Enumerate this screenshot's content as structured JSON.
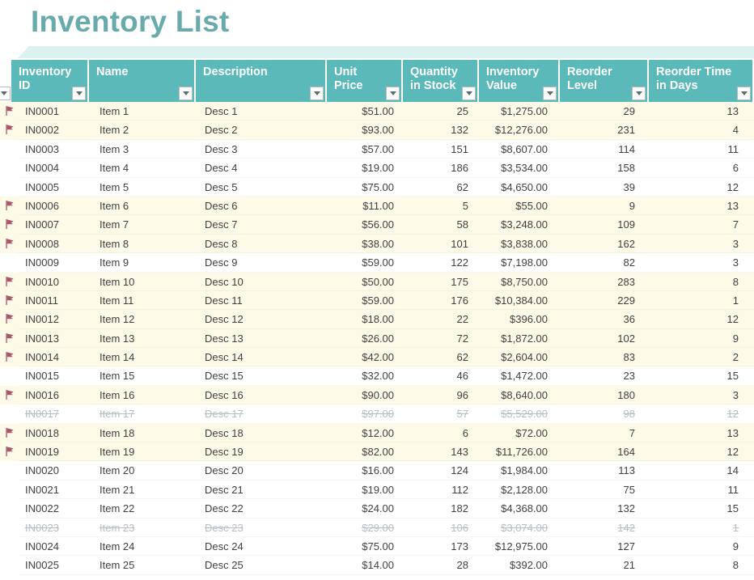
{
  "page": {
    "title": "Inventory List"
  },
  "theme": {
    "header_bg": "#5cb9b9",
    "title_color": "#69aaad",
    "band_color": "#dcf1f2",
    "flag_row_bg": "#fdfbe8",
    "plain_row_bg": "#ffffff",
    "disabled_text": "#b6bdc4",
    "flag_color": "#a8566a",
    "text_color": "#3f3f3f"
  },
  "table": {
    "filter_icon": "chevron-down-icon",
    "flag_icon": "flag-icon",
    "columns": [
      {
        "key": "flag",
        "label": "",
        "align": "left",
        "filter": true
      },
      {
        "key": "id",
        "label": "Inventory\nID",
        "align": "left",
        "filter": true
      },
      {
        "key": "name",
        "label": "Name",
        "align": "left",
        "filter": true
      },
      {
        "key": "desc",
        "label": "Description",
        "align": "left",
        "filter": true
      },
      {
        "key": "price",
        "label": "Unit Price",
        "align": "right",
        "filter": true
      },
      {
        "key": "qty",
        "label": "Quantity\nin Stock",
        "align": "right",
        "filter": true
      },
      {
        "key": "value",
        "label": "Inventory\nValue",
        "align": "right",
        "filter": true
      },
      {
        "key": "reorder",
        "label": "Reorder\nLevel",
        "align": "right",
        "filter": true
      },
      {
        "key": "days",
        "label": "Reorder Time\nin Days",
        "align": "right",
        "filter": true
      }
    ],
    "rows": [
      {
        "flag": true,
        "disabled": false,
        "id": "IN0001",
        "name": "Item 1",
        "desc": "Desc 1",
        "price": "$51.00",
        "qty": "25",
        "value": "$1,275.00",
        "reorder": "29",
        "days": "13"
      },
      {
        "flag": true,
        "disabled": false,
        "id": "IN0002",
        "name": "Item 2",
        "desc": "Desc 2",
        "price": "$93.00",
        "qty": "132",
        "value": "$12,276.00",
        "reorder": "231",
        "days": "4"
      },
      {
        "flag": false,
        "disabled": false,
        "id": "IN0003",
        "name": "Item 3",
        "desc": "Desc 3",
        "price": "$57.00",
        "qty": "151",
        "value": "$8,607.00",
        "reorder": "114",
        "days": "11"
      },
      {
        "flag": false,
        "disabled": false,
        "id": "IN0004",
        "name": "Item 4",
        "desc": "Desc 4",
        "price": "$19.00",
        "qty": "186",
        "value": "$3,534.00",
        "reorder": "158",
        "days": "6"
      },
      {
        "flag": false,
        "disabled": false,
        "id": "IN0005",
        "name": "Item 5",
        "desc": "Desc 5",
        "price": "$75.00",
        "qty": "62",
        "value": "$4,650.00",
        "reorder": "39",
        "days": "12"
      },
      {
        "flag": true,
        "disabled": false,
        "id": "IN0006",
        "name": "Item 6",
        "desc": "Desc 6",
        "price": "$11.00",
        "qty": "5",
        "value": "$55.00",
        "reorder": "9",
        "days": "13"
      },
      {
        "flag": true,
        "disabled": false,
        "id": "IN0007",
        "name": "Item 7",
        "desc": "Desc 7",
        "price": "$56.00",
        "qty": "58",
        "value": "$3,248.00",
        "reorder": "109",
        "days": "7"
      },
      {
        "flag": true,
        "disabled": false,
        "id": "IN0008",
        "name": "Item 8",
        "desc": "Desc 8",
        "price": "$38.00",
        "qty": "101",
        "value": "$3,838.00",
        "reorder": "162",
        "days": "3"
      },
      {
        "flag": false,
        "disabled": false,
        "id": "IN0009",
        "name": "Item 9",
        "desc": "Desc 9",
        "price": "$59.00",
        "qty": "122",
        "value": "$7,198.00",
        "reorder": "82",
        "days": "3"
      },
      {
        "flag": true,
        "disabled": false,
        "id": "IN0010",
        "name": "Item 10",
        "desc": "Desc 10",
        "price": "$50.00",
        "qty": "175",
        "value": "$8,750.00",
        "reorder": "283",
        "days": "8"
      },
      {
        "flag": true,
        "disabled": false,
        "id": "IN0011",
        "name": "Item 11",
        "desc": "Desc 11",
        "price": "$59.00",
        "qty": "176",
        "value": "$10,384.00",
        "reorder": "229",
        "days": "1"
      },
      {
        "flag": true,
        "disabled": false,
        "id": "IN0012",
        "name": "Item 12",
        "desc": "Desc 12",
        "price": "$18.00",
        "qty": "22",
        "value": "$396.00",
        "reorder": "36",
        "days": "12"
      },
      {
        "flag": true,
        "disabled": false,
        "id": "IN0013",
        "name": "Item 13",
        "desc": "Desc 13",
        "price": "$26.00",
        "qty": "72",
        "value": "$1,872.00",
        "reorder": "102",
        "days": "9"
      },
      {
        "flag": true,
        "disabled": false,
        "id": "IN0014",
        "name": "Item 14",
        "desc": "Desc 14",
        "price": "$42.00",
        "qty": "62",
        "value": "$2,604.00",
        "reorder": "83",
        "days": "2"
      },
      {
        "flag": false,
        "disabled": false,
        "id": "IN0015",
        "name": "Item 15",
        "desc": "Desc 15",
        "price": "$32.00",
        "qty": "46",
        "value": "$1,472.00",
        "reorder": "23",
        "days": "15"
      },
      {
        "flag": true,
        "disabled": false,
        "id": "IN0016",
        "name": "Item 16",
        "desc": "Desc 16",
        "price": "$90.00",
        "qty": "96",
        "value": "$8,640.00",
        "reorder": "180",
        "days": "3"
      },
      {
        "flag": false,
        "disabled": true,
        "id": "IN0017",
        "name": "Item 17",
        "desc": "Desc 17",
        "price": "$97.00",
        "qty": "57",
        "value": "$5,529.00",
        "reorder": "98",
        "days": "12"
      },
      {
        "flag": true,
        "disabled": false,
        "id": "IN0018",
        "name": "Item 18",
        "desc": "Desc 18",
        "price": "$12.00",
        "qty": "6",
        "value": "$72.00",
        "reorder": "7",
        "days": "13"
      },
      {
        "flag": true,
        "disabled": false,
        "id": "IN0019",
        "name": "Item 19",
        "desc": "Desc 19",
        "price": "$82.00",
        "qty": "143",
        "value": "$11,726.00",
        "reorder": "164",
        "days": "12"
      },
      {
        "flag": false,
        "disabled": false,
        "id": "IN0020",
        "name": "Item 20",
        "desc": "Desc 20",
        "price": "$16.00",
        "qty": "124",
        "value": "$1,984.00",
        "reorder": "113",
        "days": "14"
      },
      {
        "flag": false,
        "disabled": false,
        "id": "IN0021",
        "name": "Item 21",
        "desc": "Desc 21",
        "price": "$19.00",
        "qty": "112",
        "value": "$2,128.00",
        "reorder": "75",
        "days": "11"
      },
      {
        "flag": false,
        "disabled": false,
        "id": "IN0022",
        "name": "Item 22",
        "desc": "Desc 22",
        "price": "$24.00",
        "qty": "182",
        "value": "$4,368.00",
        "reorder": "132",
        "days": "15"
      },
      {
        "flag": false,
        "disabled": true,
        "id": "IN0023",
        "name": "Item 23",
        "desc": "Desc 23",
        "price": "$29.00",
        "qty": "106",
        "value": "$3,074.00",
        "reorder": "142",
        "days": "1"
      },
      {
        "flag": false,
        "disabled": false,
        "id": "IN0024",
        "name": "Item 24",
        "desc": "Desc 24",
        "price": "$75.00",
        "qty": "173",
        "value": "$12,975.00",
        "reorder": "127",
        "days": "9"
      },
      {
        "flag": false,
        "disabled": false,
        "id": "IN0025",
        "name": "Item 25",
        "desc": "Desc 25",
        "price": "$14.00",
        "qty": "28",
        "value": "$392.00",
        "reorder": "21",
        "days": "8"
      }
    ]
  }
}
